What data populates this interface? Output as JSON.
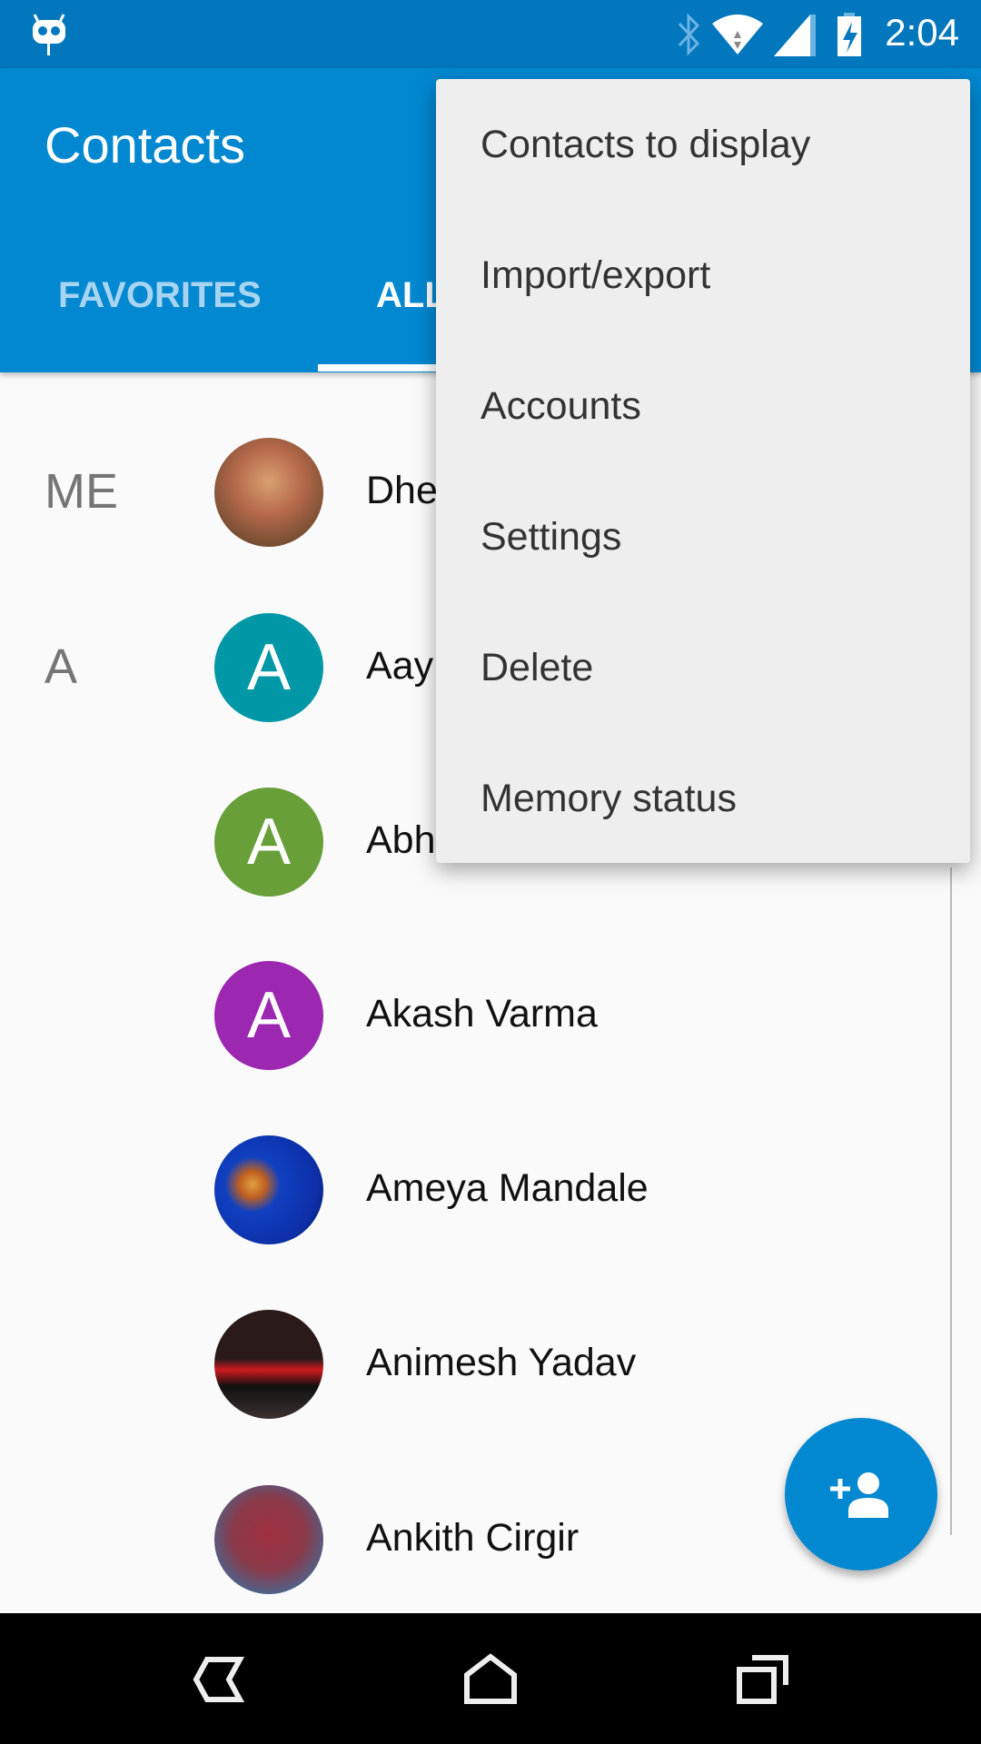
{
  "status_bar": {
    "time": "2:04",
    "icons": [
      "cyanogenmod-icon",
      "bluetooth-icon",
      "wifi-icon",
      "signal-icon",
      "battery-charging-icon"
    ]
  },
  "app_bar": {
    "title": "Contacts"
  },
  "tabs": [
    {
      "label": "FAVORITES",
      "selected": false
    },
    {
      "label": "ALL",
      "selected": true
    }
  ],
  "sections": {
    "me": "ME",
    "a": "A"
  },
  "contacts": [
    {
      "name": "Dhe",
      "avatar": "photo",
      "color": "#b5694a"
    },
    {
      "name": "Aay",
      "avatar": "A",
      "color": "#0097a7"
    },
    {
      "name": "Abh",
      "avatar": "A",
      "color": "#689f38"
    },
    {
      "name": "Akash Varma",
      "avatar": "A",
      "color": "#9c27b0"
    },
    {
      "name": "Ameya Mandale",
      "avatar": "photo",
      "color": "#0d2fa8"
    },
    {
      "name": "Animesh Yadav",
      "avatar": "photo",
      "color": "#2a1a1a"
    },
    {
      "name": "Ankith Cirgir",
      "avatar": "photo",
      "color": "#8a3a4a"
    }
  ],
  "menu": {
    "items": [
      "Contacts to display",
      "Import/export",
      "Accounts",
      "Settings",
      "Delete",
      "Memory status"
    ]
  },
  "fab": {
    "icon": "add-person-icon",
    "color": "#0288d1"
  },
  "nav_bar": {
    "icons": [
      "back-icon",
      "home-icon",
      "recents-icon"
    ]
  }
}
